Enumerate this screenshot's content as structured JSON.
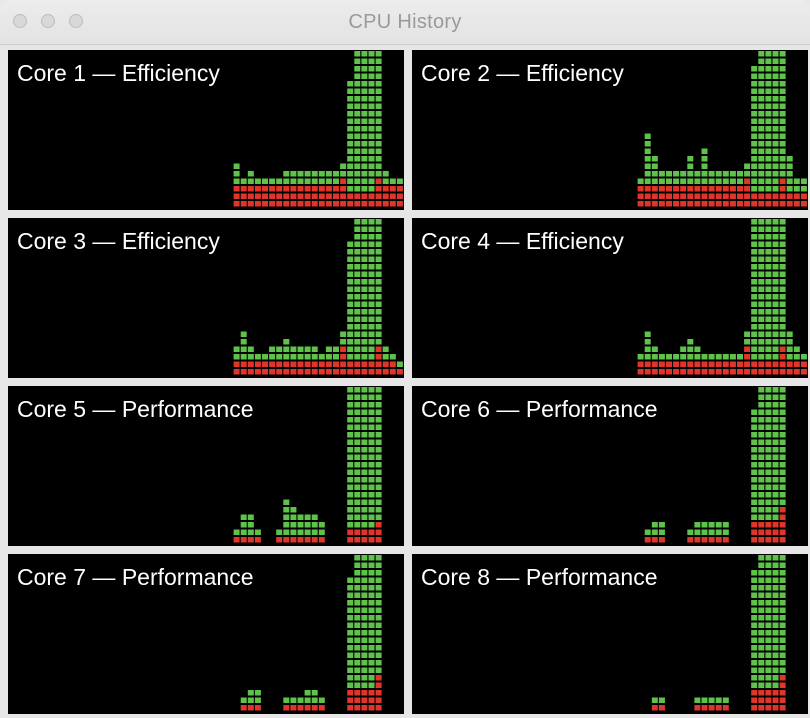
{
  "window": {
    "title": "CPU History"
  },
  "colors": {
    "user": "#5ec24b",
    "system": "#e0352b",
    "background": "#000000"
  },
  "panels": [
    {
      "label": "Core 1 — Efficiency",
      "user": [
        0,
        0,
        0,
        0,
        0,
        0,
        0,
        0,
        0,
        0,
        0,
        0,
        0,
        0,
        0,
        0,
        0,
        0,
        0,
        0,
        0,
        0,
        0,
        0,
        0,
        0,
        0,
        0,
        0,
        0,
        0,
        0,
        3,
        1,
        2,
        1,
        1,
        1,
        1,
        2,
        2,
        2,
        2,
        2,
        2,
        2,
        2,
        2,
        15,
        21,
        21,
        19,
        19,
        2,
        1,
        1
      ],
      "system": [
        0,
        0,
        0,
        0,
        0,
        0,
        0,
        0,
        0,
        0,
        0,
        0,
        0,
        0,
        0,
        0,
        0,
        0,
        0,
        0,
        0,
        0,
        0,
        0,
        0,
        0,
        0,
        0,
        0,
        0,
        0,
        0,
        3,
        3,
        3,
        3,
        3,
        3,
        3,
        3,
        3,
        3,
        3,
        3,
        3,
        3,
        3,
        4,
        2,
        2,
        2,
        2,
        4,
        3,
        3,
        3
      ]
    },
    {
      "label": "Core 2 — Efficiency",
      "user": [
        0,
        0,
        0,
        0,
        0,
        0,
        0,
        0,
        0,
        0,
        0,
        0,
        0,
        0,
        0,
        0,
        0,
        0,
        0,
        0,
        0,
        0,
        0,
        0,
        0,
        0,
        0,
        0,
        0,
        0,
        0,
        0,
        1,
        7,
        4,
        2,
        2,
        2,
        2,
        4,
        2,
        5,
        2,
        2,
        2,
        2,
        2,
        2,
        17,
        21,
        22,
        21,
        21,
        5,
        2,
        2
      ],
      "system": [
        0,
        0,
        0,
        0,
        0,
        0,
        0,
        0,
        0,
        0,
        0,
        0,
        0,
        0,
        0,
        0,
        0,
        0,
        0,
        0,
        0,
        0,
        0,
        0,
        0,
        0,
        0,
        0,
        0,
        0,
        0,
        0,
        3,
        3,
        3,
        3,
        3,
        3,
        3,
        3,
        3,
        3,
        3,
        3,
        3,
        3,
        3,
        4,
        2,
        2,
        2,
        2,
        4,
        2,
        2,
        2
      ]
    },
    {
      "label": "Core 3 — Efficiency",
      "user": [
        0,
        0,
        0,
        0,
        0,
        0,
        0,
        0,
        0,
        0,
        0,
        0,
        0,
        0,
        0,
        0,
        0,
        0,
        0,
        0,
        0,
        0,
        0,
        0,
        0,
        0,
        0,
        0,
        0,
        0,
        0,
        0,
        2,
        4,
        2,
        1,
        1,
        2,
        2,
        3,
        2,
        2,
        2,
        2,
        1,
        2,
        2,
        2,
        16,
        20,
        20,
        19,
        18,
        2,
        1,
        1
      ],
      "system": [
        0,
        0,
        0,
        0,
        0,
        0,
        0,
        0,
        0,
        0,
        0,
        0,
        0,
        0,
        0,
        0,
        0,
        0,
        0,
        0,
        0,
        0,
        0,
        0,
        0,
        0,
        0,
        0,
        0,
        0,
        0,
        0,
        2,
        2,
        2,
        2,
        2,
        2,
        2,
        2,
        2,
        2,
        2,
        2,
        2,
        2,
        2,
        4,
        2,
        2,
        2,
        2,
        4,
        2,
        2,
        1
      ]
    },
    {
      "label": "Core 4 — Efficiency",
      "user": [
        0,
        0,
        0,
        0,
        0,
        0,
        0,
        0,
        0,
        0,
        0,
        0,
        0,
        0,
        0,
        0,
        0,
        0,
        0,
        0,
        0,
        0,
        0,
        0,
        0,
        0,
        0,
        0,
        0,
        0,
        0,
        0,
        1,
        4,
        2,
        1,
        1,
        1,
        2,
        3,
        2,
        1,
        1,
        1,
        1,
        1,
        1,
        2,
        19,
        21,
        22,
        21,
        19,
        4,
        2,
        1
      ],
      "system": [
        0,
        0,
        0,
        0,
        0,
        0,
        0,
        0,
        0,
        0,
        0,
        0,
        0,
        0,
        0,
        0,
        0,
        0,
        0,
        0,
        0,
        0,
        0,
        0,
        0,
        0,
        0,
        0,
        0,
        0,
        0,
        0,
        2,
        2,
        2,
        2,
        2,
        2,
        2,
        2,
        2,
        2,
        2,
        2,
        2,
        2,
        2,
        4,
        2,
        2,
        2,
        2,
        4,
        2,
        2,
        2
      ]
    },
    {
      "label": "Core 5 — Performance",
      "user": [
        0,
        0,
        0,
        0,
        0,
        0,
        0,
        0,
        0,
        0,
        0,
        0,
        0,
        0,
        0,
        0,
        0,
        0,
        0,
        0,
        0,
        0,
        0,
        0,
        0,
        0,
        0,
        0,
        0,
        0,
        0,
        0,
        1,
        3,
        3,
        1,
        0,
        0,
        1,
        5,
        4,
        3,
        3,
        3,
        2,
        0,
        0,
        0,
        20,
        22,
        22,
        20,
        20,
        0,
        0,
        0
      ],
      "system": [
        0,
        0,
        0,
        0,
        0,
        0,
        0,
        0,
        0,
        0,
        0,
        0,
        0,
        0,
        0,
        0,
        0,
        0,
        0,
        0,
        0,
        0,
        0,
        0,
        0,
        0,
        0,
        0,
        0,
        0,
        0,
        0,
        1,
        1,
        1,
        1,
        0,
        0,
        1,
        1,
        1,
        1,
        1,
        1,
        1,
        0,
        0,
        0,
        2,
        2,
        2,
        2,
        3,
        0,
        0,
        0
      ]
    },
    {
      "label": "Core 6 — Performance",
      "user": [
        0,
        0,
        0,
        0,
        0,
        0,
        0,
        0,
        0,
        0,
        0,
        0,
        0,
        0,
        0,
        0,
        0,
        0,
        0,
        0,
        0,
        0,
        0,
        0,
        0,
        0,
        0,
        0,
        0,
        0,
        0,
        0,
        0,
        1,
        2,
        2,
        0,
        0,
        0,
        1,
        2,
        2,
        2,
        2,
        2,
        0,
        0,
        0,
        15,
        20,
        21,
        19,
        18,
        0,
        0,
        0
      ],
      "system": [
        0,
        0,
        0,
        0,
        0,
        0,
        0,
        0,
        0,
        0,
        0,
        0,
        0,
        0,
        0,
        0,
        0,
        0,
        0,
        0,
        0,
        0,
        0,
        0,
        0,
        0,
        0,
        0,
        0,
        0,
        0,
        0,
        0,
        1,
        1,
        1,
        0,
        0,
        0,
        1,
        1,
        1,
        1,
        1,
        1,
        0,
        0,
        0,
        3,
        3,
        3,
        3,
        5,
        0,
        0,
        0
      ]
    },
    {
      "label": "Core 7 — Performance",
      "user": [
        0,
        0,
        0,
        0,
        0,
        0,
        0,
        0,
        0,
        0,
        0,
        0,
        0,
        0,
        0,
        0,
        0,
        0,
        0,
        0,
        0,
        0,
        0,
        0,
        0,
        0,
        0,
        0,
        0,
        0,
        0,
        0,
        0,
        1,
        2,
        2,
        0,
        0,
        0,
        1,
        1,
        1,
        2,
        2,
        1,
        0,
        0,
        0,
        15,
        20,
        21,
        19,
        18,
        0,
        0,
        0
      ],
      "system": [
        0,
        0,
        0,
        0,
        0,
        0,
        0,
        0,
        0,
        0,
        0,
        0,
        0,
        0,
        0,
        0,
        0,
        0,
        0,
        0,
        0,
        0,
        0,
        0,
        0,
        0,
        0,
        0,
        0,
        0,
        0,
        0,
        0,
        1,
        1,
        1,
        0,
        0,
        0,
        1,
        1,
        1,
        1,
        1,
        1,
        0,
        0,
        0,
        3,
        3,
        3,
        3,
        5,
        0,
        0,
        0
      ]
    },
    {
      "label": "Core 8 — Performance",
      "user": [
        0,
        0,
        0,
        0,
        0,
        0,
        0,
        0,
        0,
        0,
        0,
        0,
        0,
        0,
        0,
        0,
        0,
        0,
        0,
        0,
        0,
        0,
        0,
        0,
        0,
        0,
        0,
        0,
        0,
        0,
        0,
        0,
        0,
        0,
        1,
        1,
        0,
        0,
        0,
        0,
        1,
        1,
        1,
        1,
        1,
        0,
        0,
        0,
        16,
        20,
        21,
        19,
        17,
        0,
        0,
        0
      ],
      "system": [
        0,
        0,
        0,
        0,
        0,
        0,
        0,
        0,
        0,
        0,
        0,
        0,
        0,
        0,
        0,
        0,
        0,
        0,
        0,
        0,
        0,
        0,
        0,
        0,
        0,
        0,
        0,
        0,
        0,
        0,
        0,
        0,
        0,
        0,
        1,
        1,
        0,
        0,
        0,
        0,
        1,
        1,
        1,
        1,
        1,
        0,
        0,
        0,
        3,
        3,
        3,
        3,
        5,
        0,
        0,
        0
      ]
    }
  ]
}
